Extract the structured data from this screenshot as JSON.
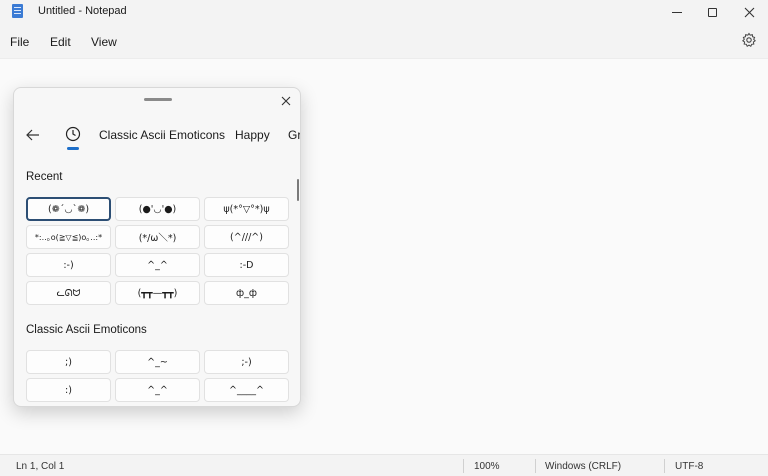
{
  "window": {
    "title": "Untitled - Notepad"
  },
  "menu": {
    "file": "File",
    "edit": "Edit",
    "view": "View"
  },
  "status": {
    "position": "Ln 1, Col 1",
    "zoom": "100%",
    "line_ending": "Windows (CRLF)",
    "encoding": "UTF-8"
  },
  "panel": {
    "tabs": {
      "classic": "Classic Ascii Emoticons",
      "happy": "Happy",
      "gr": "Gr"
    },
    "recent": {
      "title": "Recent",
      "items": [
        "(❁´◡`❁)",
        "(●'◡'●)",
        "ψ(*°▽°*)ψ",
        "*:..｡o(≧▽≦)o｡..:*",
        "(*/ω＼*)",
        "(^///^)",
        ":-)",
        "^_^",
        ":-D",
        "ᓚᘏᗢ",
        "(┳┳—┳┳)",
        "ф_ф"
      ]
    },
    "classic": {
      "title": "Classic Ascii Emoticons",
      "items": [
        ";)",
        "^_~",
        ";-)",
        ":)",
        "^_^",
        "^____^"
      ]
    }
  },
  "colors": {
    "accent": "#1e6fc9",
    "selection_border": "#2c4e74"
  }
}
